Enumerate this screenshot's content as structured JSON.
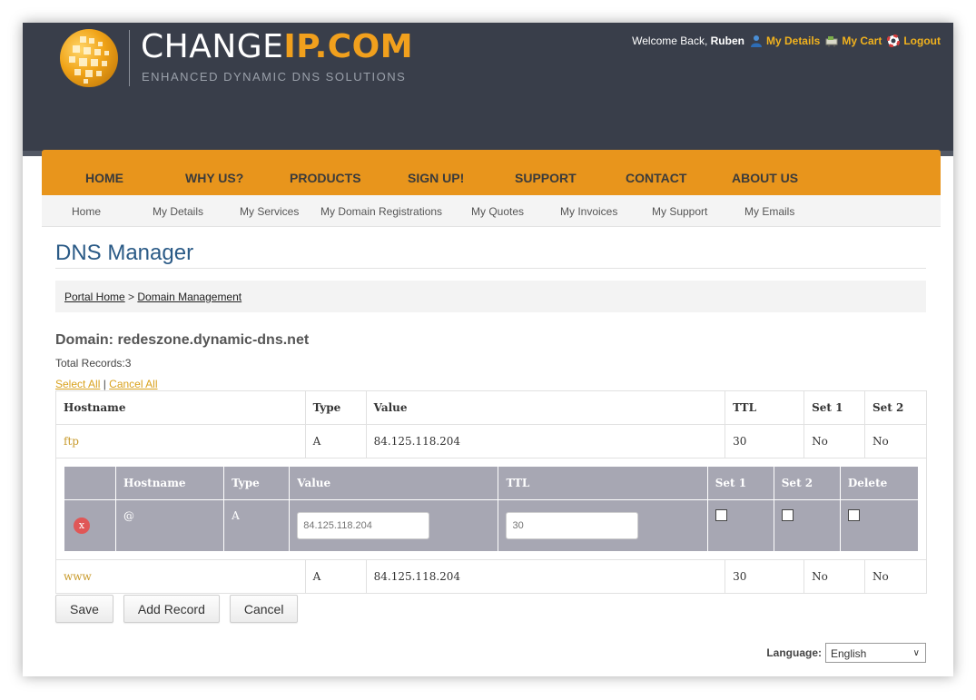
{
  "header": {
    "logo_main": "CHANGE",
    "logo_accent": "IP.COM",
    "logo_sub": "ENHANCED DYNAMIC DNS SOLUTIONS",
    "welcome": "Welcome Back, ",
    "user": "Ruben",
    "links": {
      "my_details": "My Details",
      "my_cart": "My Cart",
      "logout": "Logout"
    }
  },
  "main_nav": [
    "HOME",
    "WHY US?",
    "PRODUCTS",
    "SIGN UP!",
    "SUPPORT",
    "CONTACT",
    "ABOUT US"
  ],
  "sub_nav": [
    "Home",
    "My Details",
    "My Services",
    "My Domain Registrations",
    "My Quotes",
    "My Invoices",
    "My Support",
    "My Emails"
  ],
  "page": {
    "title": "DNS Manager",
    "breadcrumb": {
      "home": "Portal Home",
      "sep": " > ",
      "current": "Domain Management"
    },
    "domain_title": "Domain: redeszone.dynamic-dns.net",
    "total_records": "Total Records:3",
    "select_all": "Select All",
    "cancel_all": "Cancel All",
    "select_sep": " | "
  },
  "records": {
    "headers": [
      "Hostname",
      "Type",
      "Value",
      "TTL",
      "Set 1",
      "Set 2"
    ],
    "rows": [
      {
        "host": "ftp",
        "type": "A",
        "value": "84.125.118.204",
        "ttl": "30",
        "set1": "No",
        "set2": "No"
      },
      {
        "host": "www",
        "type": "A",
        "value": "84.125.118.204",
        "ttl": "30",
        "set1": "No",
        "set2": "No"
      }
    ]
  },
  "edit_row": {
    "headers": [
      "",
      "Hostname",
      "Type",
      "Value",
      "TTL",
      "Set 1",
      "Set 2",
      "Delete"
    ],
    "delete_glyph": "x",
    "host": "@",
    "type": "A",
    "value_placeholder": "84.125.118.204",
    "ttl_placeholder": "30"
  },
  "buttons": {
    "save": "Save",
    "add_record": "Add Record",
    "cancel": "Cancel"
  },
  "language": {
    "label": "Language:",
    "selected": "English"
  },
  "colors": {
    "header_bg": "#393e4a",
    "nav_orange": "#e8951c",
    "accent_gold": "#f1b21e",
    "title_blue": "#2a5a86"
  },
  "icons": {
    "my_details": "user-icon",
    "my_cart": "cart-icon",
    "logout": "lifebuoy-icon",
    "delete": "close-icon",
    "dropdown": "chevron-down-icon"
  }
}
